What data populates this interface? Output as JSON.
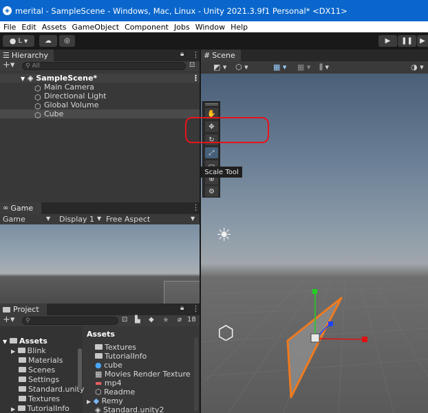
{
  "window": {
    "title": "merital - SampleScene - Windows, Mac, Linux - Unity 2021.3.9f1 Personal* <DX11>"
  },
  "menu": [
    "File",
    "Edit",
    "Assets",
    "GameObject",
    "Component",
    "Jobs",
    "Window",
    "Help"
  ],
  "toolbar": {
    "account_label": "L"
  },
  "hierarchy": {
    "tab_label": "Hierarchy",
    "search_placeholder": "All",
    "scene_name": "SampleScene*",
    "items": [
      "Main Camera",
      "Directional Light",
      "Global Volume",
      "Cube"
    ]
  },
  "game": {
    "tab_label": "Game",
    "mode": "Game",
    "display": "Display 1",
    "aspect": "Free Aspect"
  },
  "project": {
    "tab_label": "Project",
    "hidden_count": "18",
    "tree": [
      "Assets",
      "Blink",
      "Materials",
      "Scenes",
      "Settings",
      "Standard.unity",
      "Textures",
      "TutorialInfo"
    ],
    "assets_header": "Assets",
    "files": [
      "Textures",
      "TutorialInfo",
      "cube",
      "Movies Render Texture",
      "mp4",
      "Readme",
      "Remy",
      "Standard.unity2"
    ]
  },
  "scene": {
    "tab_label": "Scene",
    "tooltip": "Scale Tool"
  },
  "colors": {
    "titlebar": "#0a66cc",
    "highlight": "#e8141c",
    "selection_outline": "#f07a1e",
    "gizmo_x": "#e01010",
    "gizmo_y": "#20d020",
    "gizmo_z": "#2040ff"
  }
}
